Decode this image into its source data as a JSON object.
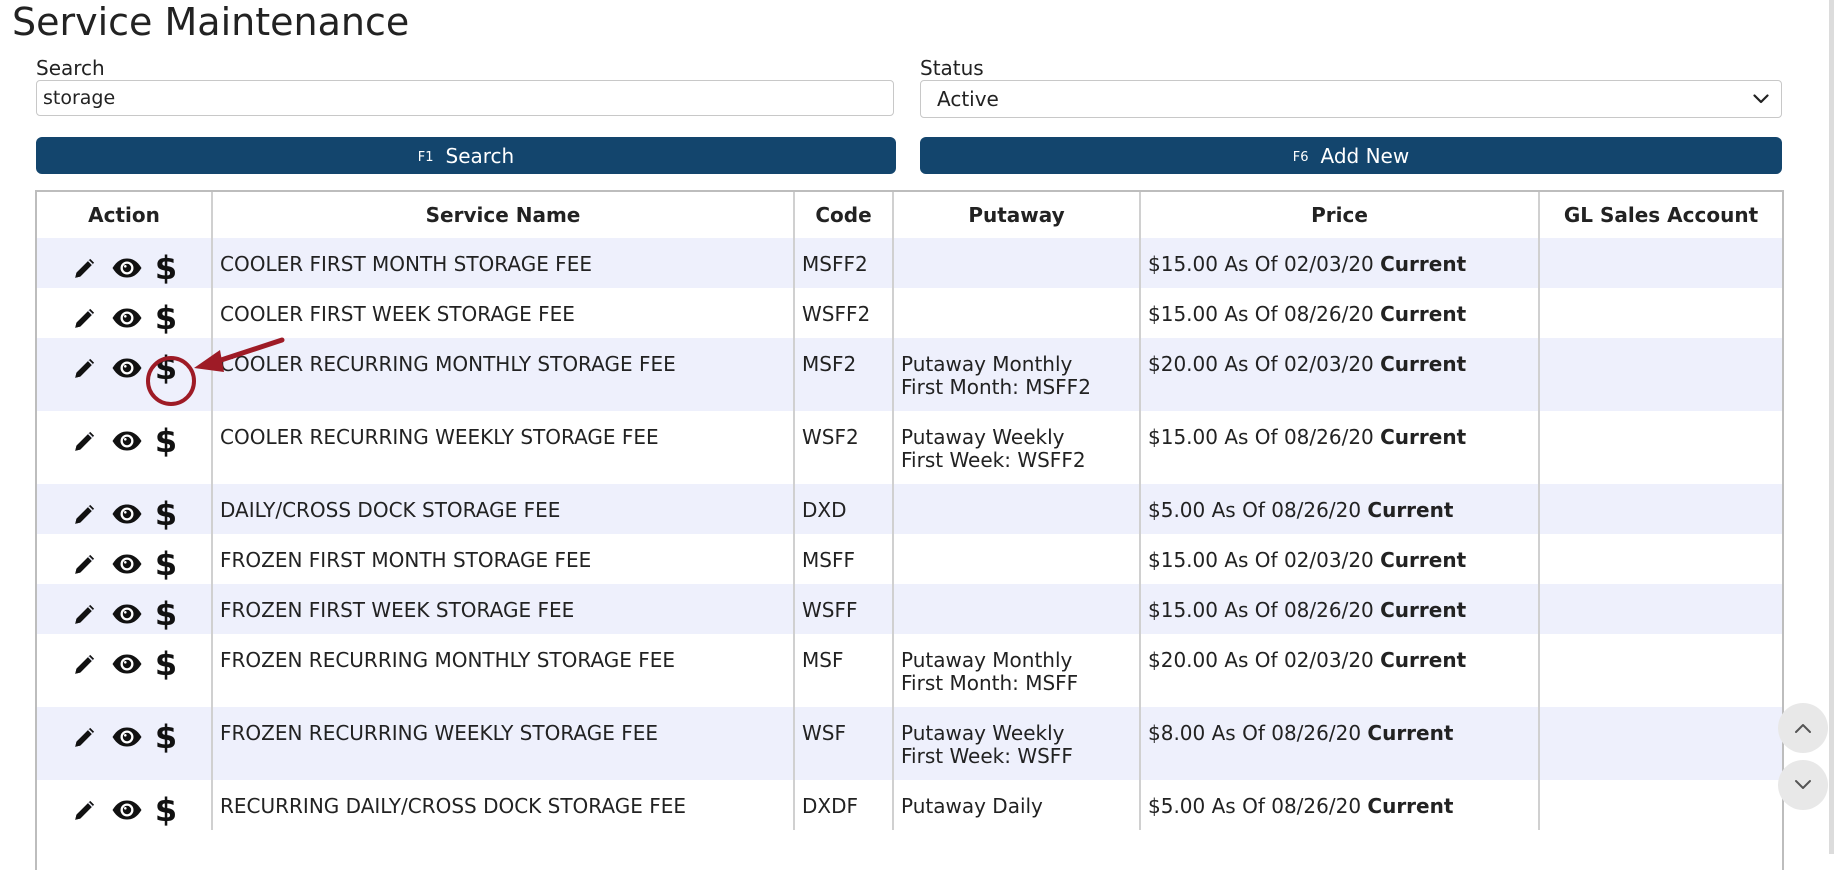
{
  "page": {
    "title": "Service Maintenance"
  },
  "filters": {
    "search_label": "Search",
    "search_value": "storage",
    "status_label": "Status",
    "status_value": "Active"
  },
  "buttons": {
    "search": {
      "fkey": "F1",
      "label": "Search"
    },
    "add_new": {
      "fkey": "F6",
      "label": "Add New"
    }
  },
  "table": {
    "headers": [
      "Action",
      "Service Name",
      "Code",
      "Putaway",
      "Price",
      "GL Sales Account"
    ],
    "rows": [
      {
        "name": "COOLER FIRST MONTH STORAGE FEE",
        "code": "MSFF2",
        "putaway1": "",
        "putaway2": "",
        "price": "$15.00 As Of 02/03/20",
        "status": "Current",
        "gl": ""
      },
      {
        "name": "COOLER FIRST WEEK STORAGE FEE",
        "code": "WSFF2",
        "putaway1": "",
        "putaway2": "",
        "price": "$15.00 As Of 08/26/20",
        "status": "Current",
        "gl": ""
      },
      {
        "name": "COOLER RECURRING MONTHLY STORAGE FEE",
        "code": "MSF2",
        "putaway1": "Putaway Monthly",
        "putaway2": "First Month: MSFF2",
        "price": "$20.00 As Of 02/03/20",
        "status": "Current",
        "gl": ""
      },
      {
        "name": "COOLER RECURRING WEEKLY STORAGE FEE",
        "code": "WSF2",
        "putaway1": "Putaway Weekly",
        "putaway2": "First Week: WSFF2",
        "price": "$15.00 As Of 08/26/20",
        "status": "Current",
        "gl": ""
      },
      {
        "name": "DAILY/CROSS DOCK STORAGE FEE",
        "code": "DXD",
        "putaway1": "",
        "putaway2": "",
        "price": "$5.00 As Of 08/26/20",
        "status": "Current",
        "gl": ""
      },
      {
        "name": "FROZEN FIRST MONTH STORAGE FEE",
        "code": "MSFF",
        "putaway1": "",
        "putaway2": "",
        "price": "$15.00 As Of 02/03/20",
        "status": "Current",
        "gl": ""
      },
      {
        "name": "FROZEN FIRST WEEK STORAGE FEE",
        "code": "WSFF",
        "putaway1": "",
        "putaway2": "",
        "price": "$15.00 As Of 08/26/20",
        "status": "Current",
        "gl": ""
      },
      {
        "name": "FROZEN RECURRING MONTHLY STORAGE FEE",
        "code": "MSF",
        "putaway1": "Putaway Monthly",
        "putaway2": "First Month: MSFF",
        "price": "$20.00 As Of 02/03/20",
        "status": "Current",
        "gl": ""
      },
      {
        "name": "FROZEN RECURRING WEEKLY STORAGE FEE",
        "code": "WSF",
        "putaway1": "Putaway Weekly",
        "putaway2": "First Week: WSFF",
        "price": "$8.00 As Of 08/26/20",
        "status": "Current",
        "gl": ""
      },
      {
        "name": "RECURRING DAILY/CROSS DOCK STORAGE FEE",
        "code": "DXDF",
        "putaway1": "Putaway Daily",
        "putaway2": "",
        "price": "$5.00 As Of 08/26/20",
        "status": "Current",
        "gl": ""
      }
    ]
  },
  "icons": {
    "edit": "pencil-icon",
    "view": "eye-icon",
    "pricing": "dollar-icon",
    "scroll_up": "chevron-up-icon",
    "scroll_down": "chevron-down-icon"
  },
  "colors": {
    "button_bg": "#13456d",
    "row_alt": "#eef0fc",
    "annotation": "#9e1b26"
  },
  "annotation": {
    "highlighted_row": 2,
    "highlighted_icon": "dollar-icon"
  }
}
